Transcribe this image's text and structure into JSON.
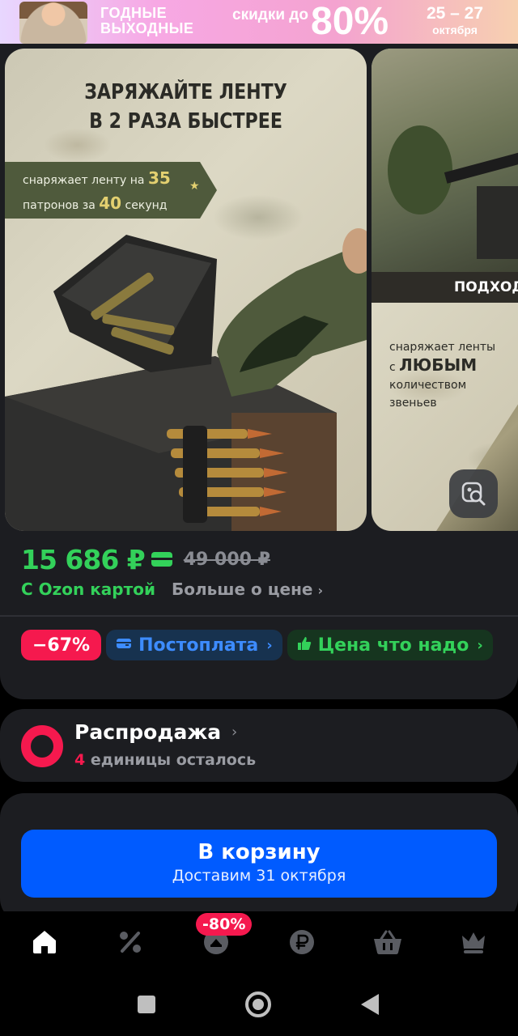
{
  "promo": {
    "line1": "ГОДНЫЕ ВЫХОДНЫЕ",
    "line2": "скидки до",
    "percent": "80%",
    "dates": "25 – 27",
    "month": "октября"
  },
  "gallery": {
    "slide1": {
      "headline_1": "ЗАРЯЖАЙТЕ ЛЕНТУ",
      "headline_2": "В 2 РАЗА БЫСТРЕЕ",
      "ribbon_a": "снаряжает ленту",
      "ribbon_b": "на",
      "ribbon_num1": "35",
      "ribbon_c": "патронов",
      "ribbon_d": "за",
      "ribbon_num2": "40",
      "ribbon_e": "секунд"
    },
    "slide2": {
      "bar_text": "ПОДХОДИ",
      "text_1": "снаряжает ленты",
      "text_2": "с",
      "text_big": "ЛЮБЫМ",
      "text_3": "количеством",
      "text_4": "звеньев"
    }
  },
  "pricing": {
    "price": "15 686 ₽",
    "old_price": "49 000 ₽",
    "ozon_card": "С Ozon картой",
    "more_about_price": "Больше о цене"
  },
  "chips": {
    "discount": "−67%",
    "postpay": "Постоплата",
    "good_price": "Цена что надо"
  },
  "sale": {
    "title": "Распродажа",
    "count": "4",
    "remaining": "единицы осталось"
  },
  "cart": {
    "button": "В корзину",
    "delivery": "Доставим 31 октября"
  },
  "tabbar": {
    "badge": "-80%",
    "items": [
      "home-icon",
      "percent-icon",
      "fresh-icon",
      "ruble-icon",
      "basket-icon",
      "crown-icon"
    ]
  },
  "colors": {
    "accent_green": "#33d15a",
    "accent_blue": "#005bff",
    "accent_red": "#f5194e"
  }
}
